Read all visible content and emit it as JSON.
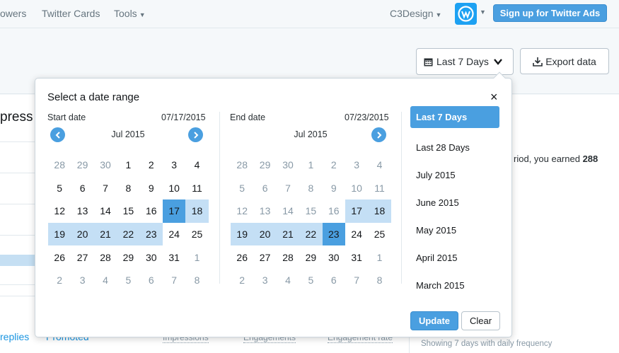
{
  "topnav": {
    "links": [
      "owers",
      "Twitter Cards",
      "Tools"
    ],
    "account": "C3Design",
    "signup": "Sign up for Twitter Ads"
  },
  "header": {
    "range_label": "Last 7 Days",
    "export_label": "Export data"
  },
  "background": {
    "title_fragment": "press",
    "earned_text": "riod, you earned ",
    "earned_value": "288",
    "tabs": [
      "replies",
      "Promoted"
    ],
    "columns": [
      "Impressions",
      "Engagements",
      "Engagement rate"
    ],
    "showing": "Showing 7 days with daily frequency"
  },
  "popup": {
    "title": "Select a date range",
    "close": "×",
    "start": {
      "label": "Start date",
      "date": "07/17/2015",
      "month": "Jul 2015",
      "days": [
        [
          "28",
          "other"
        ],
        [
          "29",
          "other"
        ],
        [
          "30",
          "other"
        ],
        [
          "1",
          ""
        ],
        [
          "2",
          ""
        ],
        [
          "3",
          ""
        ],
        [
          "4",
          ""
        ],
        [
          "5",
          ""
        ],
        [
          "6",
          ""
        ],
        [
          "7",
          ""
        ],
        [
          "8",
          ""
        ],
        [
          "9",
          ""
        ],
        [
          "10",
          ""
        ],
        [
          "11",
          ""
        ],
        [
          "12",
          ""
        ],
        [
          "13",
          ""
        ],
        [
          "14",
          ""
        ],
        [
          "15",
          ""
        ],
        [
          "16",
          ""
        ],
        [
          "17",
          "selected"
        ],
        [
          "18",
          "inrange"
        ],
        [
          "19",
          "inrange"
        ],
        [
          "20",
          "inrange"
        ],
        [
          "21",
          "inrange"
        ],
        [
          "22",
          "inrange"
        ],
        [
          "23",
          "inrange"
        ],
        [
          "24",
          ""
        ],
        [
          "25",
          ""
        ],
        [
          "26",
          ""
        ],
        [
          "27",
          ""
        ],
        [
          "28",
          ""
        ],
        [
          "29",
          ""
        ],
        [
          "30",
          ""
        ],
        [
          "31",
          ""
        ],
        [
          "1",
          "other"
        ],
        [
          "2",
          "other"
        ],
        [
          "3",
          "other"
        ],
        [
          "4",
          "other"
        ],
        [
          "5",
          "other"
        ],
        [
          "6",
          "other"
        ],
        [
          "7",
          "other"
        ],
        [
          "8",
          "other"
        ]
      ]
    },
    "end": {
      "label": "End date",
      "date": "07/23/2015",
      "month": "Jul 2015",
      "days": [
        [
          "28",
          "other"
        ],
        [
          "29",
          "other"
        ],
        [
          "30",
          "other"
        ],
        [
          "1",
          "other"
        ],
        [
          "2",
          "other"
        ],
        [
          "3",
          "other"
        ],
        [
          "4",
          "other"
        ],
        [
          "5",
          "other"
        ],
        [
          "6",
          "other"
        ],
        [
          "7",
          "other"
        ],
        [
          "8",
          "other"
        ],
        [
          "9",
          "other"
        ],
        [
          "10",
          "other"
        ],
        [
          "11",
          "other"
        ],
        [
          "12",
          "other"
        ],
        [
          "13",
          "other"
        ],
        [
          "14",
          "other"
        ],
        [
          "15",
          "other"
        ],
        [
          "16",
          "other"
        ],
        [
          "17",
          "inrange"
        ],
        [
          "18",
          "inrange"
        ],
        [
          "19",
          "inrange"
        ],
        [
          "20",
          "inrange"
        ],
        [
          "21",
          "inrange"
        ],
        [
          "22",
          "inrange"
        ],
        [
          "23",
          "selected"
        ],
        [
          "24",
          ""
        ],
        [
          "25",
          ""
        ],
        [
          "26",
          ""
        ],
        [
          "27",
          ""
        ],
        [
          "28",
          ""
        ],
        [
          "29",
          ""
        ],
        [
          "30",
          ""
        ],
        [
          "31",
          ""
        ],
        [
          "1",
          "other"
        ],
        [
          "2",
          "other"
        ],
        [
          "3",
          "other"
        ],
        [
          "4",
          "other"
        ],
        [
          "5",
          "other"
        ],
        [
          "6",
          "other"
        ],
        [
          "7",
          "other"
        ],
        [
          "8",
          "other"
        ]
      ]
    },
    "presets": [
      "Last 7 Days",
      "Last 28 Days",
      "July 2015",
      "June 2015",
      "May 2015",
      "April 2015",
      "March 2015"
    ],
    "active_preset": 0,
    "update_label": "Update",
    "clear_label": "Clear"
  }
}
